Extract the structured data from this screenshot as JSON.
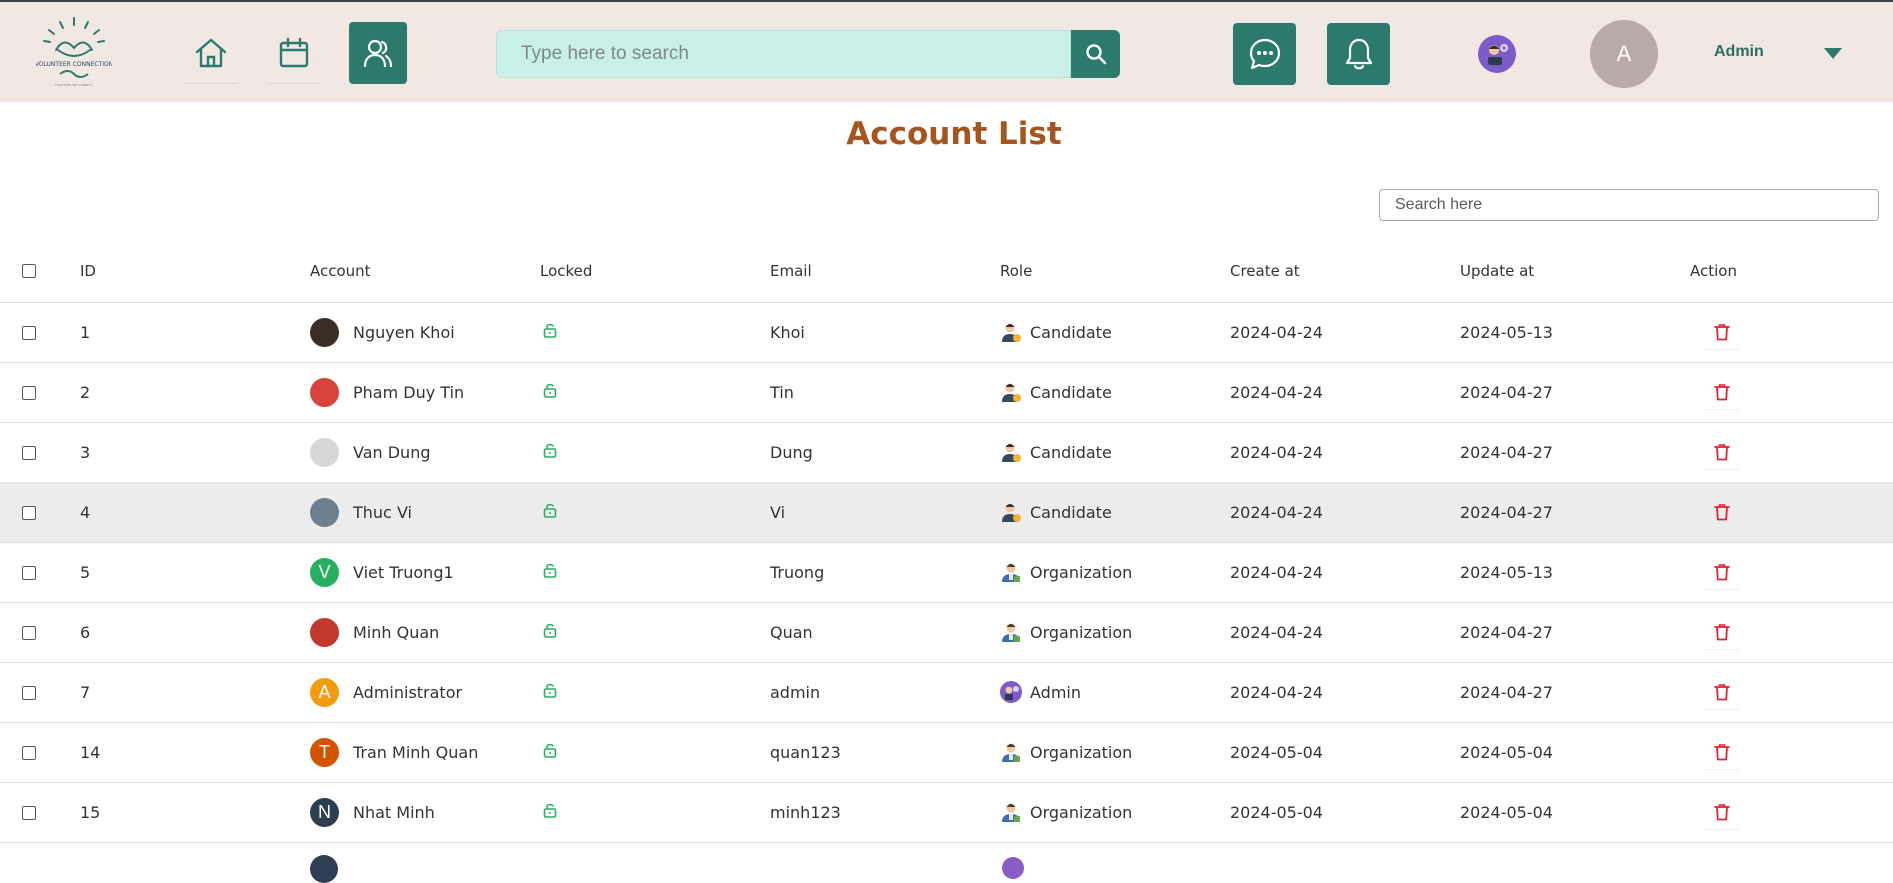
{
  "header": {
    "logo_alt": "VOLUNTEER CONNECTION",
    "search_placeholder": "Type here to search",
    "user_initial": "A",
    "user_name": "Admin"
  },
  "page": {
    "title": "Account List",
    "search_placeholder": "Search here"
  },
  "table": {
    "columns": [
      "ID",
      "Account",
      "Locked",
      "Email",
      "Role",
      "Create at",
      "Update at",
      "Action"
    ],
    "rows": [
      {
        "id": "1",
        "account": "Nguyen Khoi",
        "email": "Khoi",
        "role": "Candidate",
        "created": "2024-04-24",
        "updated": "2024-05-13",
        "avatar_color": "#3b2e25",
        "avatar_letter": ""
      },
      {
        "id": "2",
        "account": "Pham Duy Tin",
        "email": "Tin",
        "role": "Candidate",
        "created": "2024-04-24",
        "updated": "2024-04-27",
        "avatar_color": "#d8433b",
        "avatar_letter": ""
      },
      {
        "id": "3",
        "account": "Van Dung",
        "email": "Dung",
        "role": "Candidate",
        "created": "2024-04-24",
        "updated": "2024-04-27",
        "avatar_color": "#d9d6d6",
        "avatar_letter": ""
      },
      {
        "id": "4",
        "account": "Thuc Vi",
        "email": "Vi",
        "role": "Candidate",
        "created": "2024-04-24",
        "updated": "2024-04-27",
        "avatar_color": "#6e7f8e",
        "avatar_letter": ""
      },
      {
        "id": "5",
        "account": "Viet Truong1",
        "email": "Truong",
        "role": "Organization",
        "created": "2024-04-24",
        "updated": "2024-05-13",
        "avatar_color": "#27ae60",
        "avatar_letter": "V"
      },
      {
        "id": "6",
        "account": "Minh Quan",
        "email": "Quan",
        "role": "Organization",
        "created": "2024-04-24",
        "updated": "2024-04-27",
        "avatar_color": "#c0392b",
        "avatar_letter": ""
      },
      {
        "id": "7",
        "account": "Administrator",
        "email": "admin",
        "role": "Admin",
        "created": "2024-04-24",
        "updated": "2024-04-27",
        "avatar_color": "#f39c12",
        "avatar_letter": "A"
      },
      {
        "id": "14",
        "account": "Tran Minh Quan",
        "email": "quan123",
        "role": "Organization",
        "created": "2024-05-04",
        "updated": "2024-05-04",
        "avatar_color": "#d35400",
        "avatar_letter": "T"
      },
      {
        "id": "15",
        "account": "Nhat Minh",
        "email": "minh123",
        "role": "Organization",
        "created": "2024-05-04",
        "updated": "2024-05-04",
        "avatar_color": "#2c3e50",
        "avatar_letter": "N"
      }
    ]
  },
  "colors": {
    "header_bg": "#f2e8e3",
    "accent": "#2b7a6b",
    "title": "#a4561e",
    "unlock_icon": "#27ae60",
    "delete_icon": "#e0242f",
    "highlight_row": "#ececec"
  },
  "icons": {
    "nav": [
      "home-icon",
      "calendar-icon",
      "users-icon"
    ],
    "header": [
      "search-icon",
      "chat-icon",
      "bell-icon",
      "chevron-down-icon"
    ],
    "row": [
      "unlock-icon",
      "trash-icon"
    ]
  }
}
